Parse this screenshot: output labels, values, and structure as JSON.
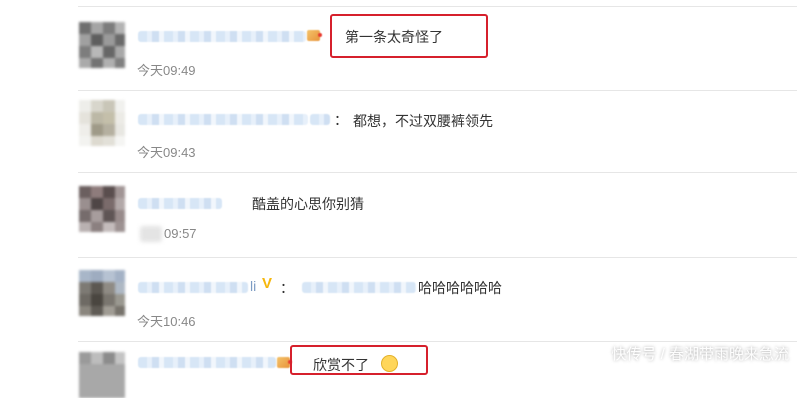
{
  "comments": [
    {
      "text": "第一条太奇怪了",
      "time": "今天09:49"
    },
    {
      "separator": "：",
      "text": "都想，不过双腰裤领先",
      "time": "今天09:43"
    },
    {
      "text": "酷盖的心思你别猜",
      "time": "09:57"
    },
    {
      "name_visible": "li",
      "separator": "：",
      "text": "哈哈哈哈哈哈",
      "time": "今天10:46"
    },
    {
      "text": "欣赏不了"
    }
  ],
  "watermark": "快传号 / 春湖带雨晚来急流",
  "colors": {
    "highlight_box": "#d6202c",
    "time_text": "#888888",
    "comment_text": "#333333",
    "vip_badge": "#f6b70d"
  },
  "icons": [
    "member-badge-icon",
    "vip-v-icon",
    "emoji-icon"
  ]
}
